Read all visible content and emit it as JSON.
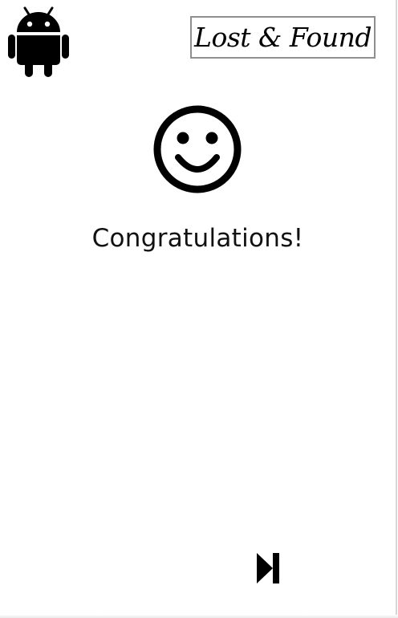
{
  "app": {
    "logo_text": "Lost & Found"
  },
  "main": {
    "message": "Congratulations!"
  },
  "icons": {
    "platform": "android-icon",
    "status": "smiley-face-icon",
    "next": "skip-next-icon"
  },
  "colors": {
    "foreground": "#000000",
    "background": "#ffffff",
    "logo_border": "#8f8f8f"
  }
}
